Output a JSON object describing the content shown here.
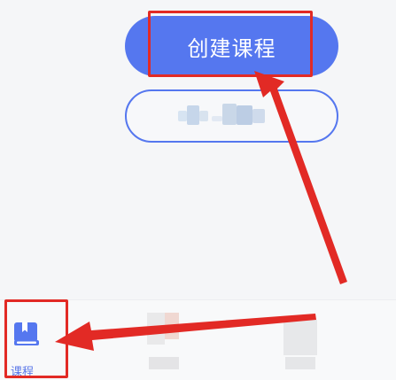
{
  "main": {
    "create_course_label": "创建课程",
    "secondary_label": ""
  },
  "tabbar": {
    "active_tab_label": "课程"
  },
  "colors": {
    "primary": "#5577ef",
    "annotation": "#e22a25",
    "background": "#f5f6f8"
  },
  "icons": {
    "active_tab_icon": "book-icon"
  }
}
